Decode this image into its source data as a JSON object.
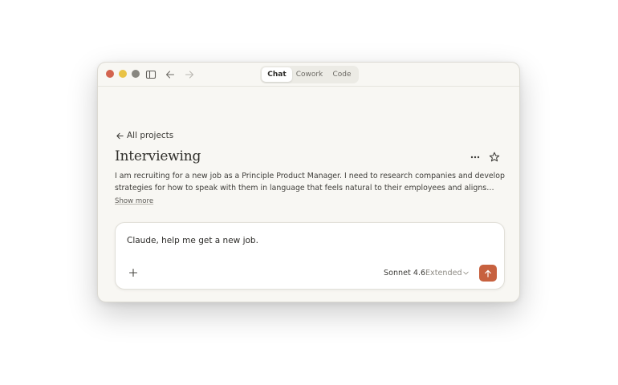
{
  "tabs": [
    {
      "label": "Chat",
      "active": true
    },
    {
      "label": "Cowork",
      "active": false
    },
    {
      "label": "Code",
      "active": false
    }
  ],
  "nav": {
    "back_label": "All projects"
  },
  "project": {
    "title": "Interviewing",
    "description": "I am recruiting for a new job as a Principle Product Manager. I need to research companies and develop strategies for how to speak with them in language that feels natural to their employees and aligns with their values and culture.",
    "show_more_label": "Show more"
  },
  "composer": {
    "text": "Claude, help me get a new job.",
    "model": "Sonnet 4.6",
    "mode": "Extended"
  },
  "icons": {
    "window_close": "red-traffic-light",
    "window_minimize": "yellow-traffic-light",
    "window_zoom": "gray-traffic-light",
    "sidebar": "sidebar-toggle-icon",
    "back": "arrow-left-icon",
    "forward": "arrow-right-icon",
    "more": "ellipsis-icon",
    "favorite": "star-icon",
    "attach": "plus-icon",
    "model_menu": "chevron-down-icon",
    "send": "arrow-up-icon"
  },
  "colors": {
    "accent": "#c7613f",
    "window_bg": "#f8f7f3",
    "close": "#d3644f",
    "minimize": "#e9c346",
    "zoom": "#888780"
  }
}
